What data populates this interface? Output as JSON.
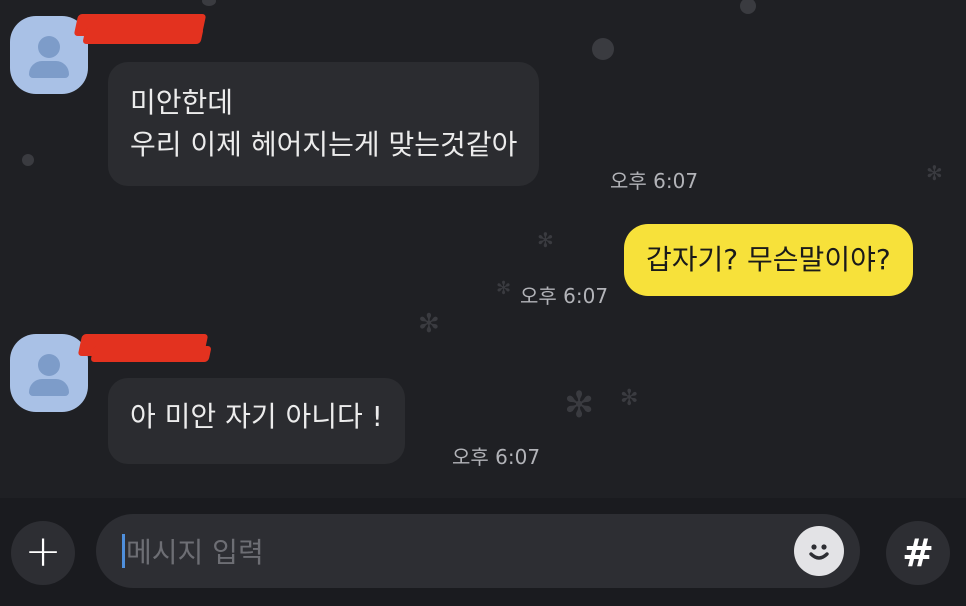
{
  "messages": [
    {
      "side": "in",
      "lines": [
        "미안한데",
        "우리 이제 헤어지는게 맞는것같아"
      ],
      "time": "오후 6:07"
    },
    {
      "side": "out",
      "text": "갑자기? 무슨말이야?",
      "time": "오후 6:07"
    },
    {
      "side": "in",
      "text": "아 미안 자기 아니다 !",
      "time": "오후 6:07"
    }
  ],
  "composer": {
    "add_symbol": "+",
    "placeholder": "메시지 입력",
    "hashtag_symbol": "#"
  },
  "icons": [
    "avatar-icon",
    "plus-icon",
    "emoji-icon",
    "hashtag-icon"
  ],
  "colors": {
    "background": "#1f2024",
    "incoming_bubble": "#2b2c30",
    "outgoing_bubble": "#f7e13a",
    "avatar": "#a9c1e6",
    "redaction": "#e3321f"
  }
}
